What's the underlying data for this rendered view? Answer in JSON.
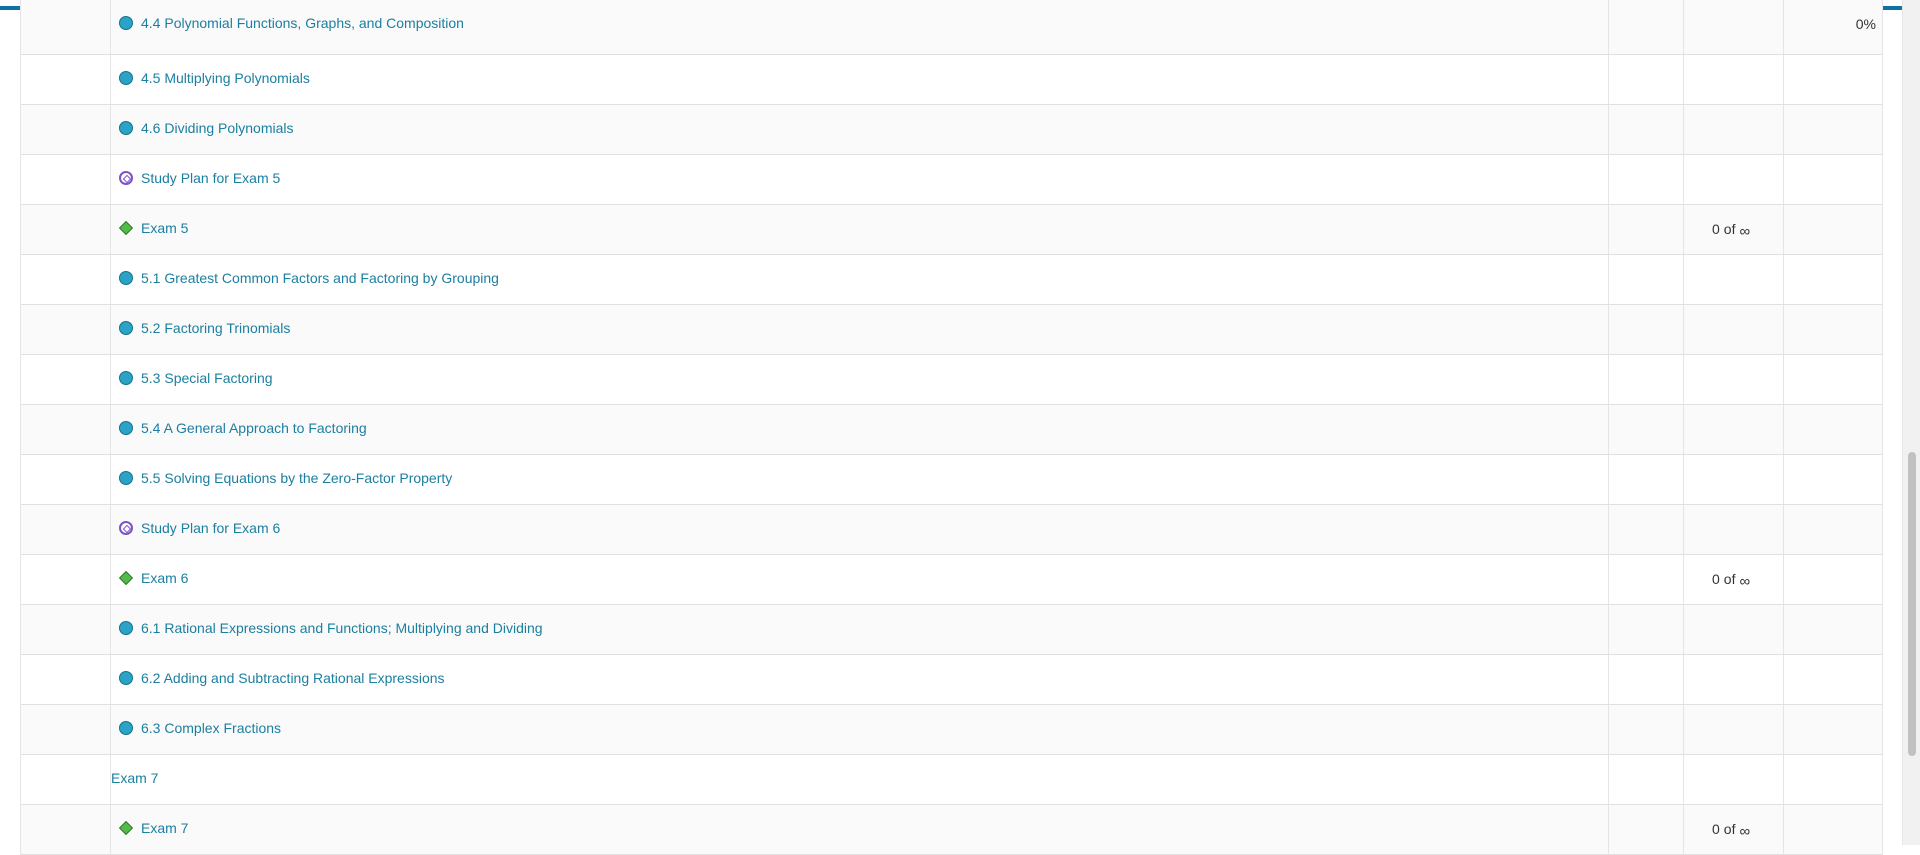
{
  "colors": {
    "link": "#1b7fa0",
    "top_bar": "#0f72a0",
    "lesson_icon": "#2aa3c6",
    "exam_icon": "#55b94c",
    "study_icon": "#7b52c9"
  },
  "rows": [
    {
      "icon": "lesson-circle-icon",
      "title": "4.4 Polynomial Functions, Graphs, and Composition",
      "attempts_value": "",
      "attempts_of": "",
      "attempts_symbol": "",
      "score": "0%"
    },
    {
      "icon": "lesson-circle-icon",
      "title": "4.5 Multiplying Polynomials",
      "attempts_value": "",
      "attempts_of": "",
      "attempts_symbol": "",
      "score": ""
    },
    {
      "icon": "lesson-circle-icon",
      "title": "4.6 Dividing Polynomials",
      "attempts_value": "",
      "attempts_of": "",
      "attempts_symbol": "",
      "score": ""
    },
    {
      "icon": "study-plan-icon",
      "title": "Study Plan for Exam 5",
      "attempts_value": "",
      "attempts_of": "",
      "attempts_symbol": "",
      "score": ""
    },
    {
      "icon": "exam-diamond-icon",
      "title": "Exam 5",
      "attempts_value": "0",
      "attempts_of": "of",
      "attempts_symbol": "∞",
      "score": ""
    },
    {
      "icon": "lesson-circle-icon",
      "title": "5.1 Greatest Common Factors and Factoring by Grouping",
      "attempts_value": "",
      "attempts_of": "",
      "attempts_symbol": "",
      "score": ""
    },
    {
      "icon": "lesson-circle-icon",
      "title": "5.2 Factoring Trinomials",
      "attempts_value": "",
      "attempts_of": "",
      "attempts_symbol": "",
      "score": ""
    },
    {
      "icon": "lesson-circle-icon",
      "title": "5.3 Special Factoring",
      "attempts_value": "",
      "attempts_of": "",
      "attempts_symbol": "",
      "score": ""
    },
    {
      "icon": "lesson-circle-icon",
      "title": "5.4 A General Approach to Factoring",
      "attempts_value": "",
      "attempts_of": "",
      "attempts_symbol": "",
      "score": ""
    },
    {
      "icon": "lesson-circle-icon",
      "title": "5.5 Solving Equations by the Zero-Factor Property",
      "attempts_value": "",
      "attempts_of": "",
      "attempts_symbol": "",
      "score": ""
    },
    {
      "icon": "study-plan-icon",
      "title": "Study Plan for Exam 6",
      "attempts_value": "",
      "attempts_of": "",
      "attempts_symbol": "",
      "score": ""
    },
    {
      "icon": "exam-diamond-icon",
      "title": "Exam 6",
      "attempts_value": "0",
      "attempts_of": "of",
      "attempts_symbol": "∞",
      "score": ""
    },
    {
      "icon": "lesson-circle-icon",
      "title": "6.1 Rational Expressions and Functions; Multiplying and Dividing",
      "attempts_value": "",
      "attempts_of": "",
      "attempts_symbol": "",
      "score": ""
    },
    {
      "icon": "lesson-circle-icon",
      "title": "6.2 Adding and Subtracting Rational Expressions",
      "attempts_value": "",
      "attempts_of": "",
      "attempts_symbol": "",
      "score": ""
    },
    {
      "icon": "lesson-circle-icon",
      "title": "6.3 Complex Fractions",
      "attempts_value": "",
      "attempts_of": "",
      "attempts_symbol": "",
      "score": ""
    },
    {
      "icon": "",
      "title": "Exam 7",
      "attempts_value": "",
      "attempts_of": "",
      "attempts_symbol": "",
      "score": ""
    },
    {
      "icon": "exam-diamond-icon",
      "title": "Exam 7",
      "attempts_value": "0",
      "attempts_of": "of",
      "attempts_symbol": "∞",
      "score": ""
    }
  ]
}
